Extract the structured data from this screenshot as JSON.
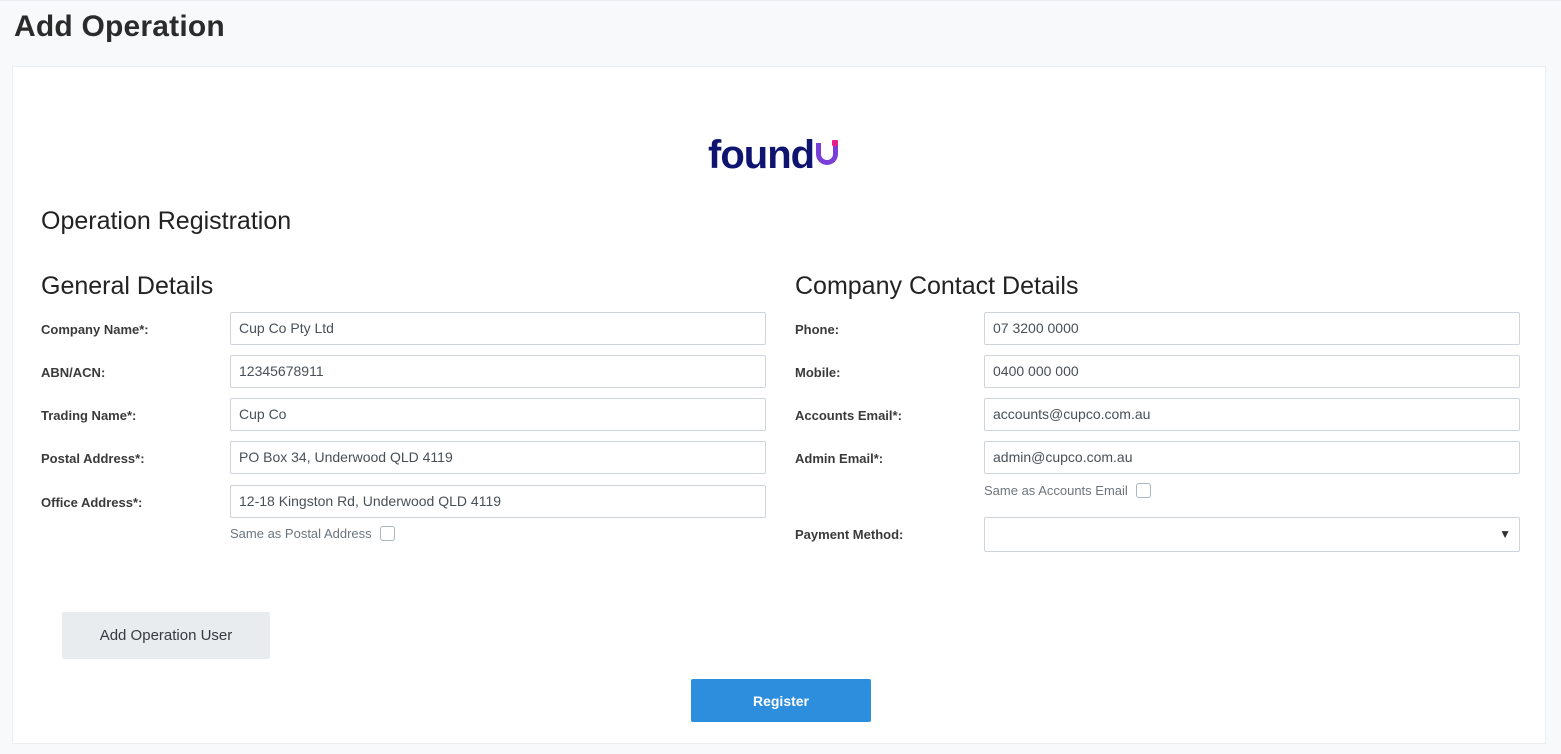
{
  "page": {
    "title": "Add Operation"
  },
  "brand": {
    "logo_text": "found",
    "logo_navy": "#0f1470",
    "logo_purple": "#7a3fd8",
    "logo_pink": "#e91e8c"
  },
  "form": {
    "heading": "Operation Registration",
    "general": {
      "heading": "General Details",
      "company_name": {
        "label": "Company Name*:",
        "value": "Cup Co Pty Ltd"
      },
      "abn": {
        "label": "ABN/ACN:",
        "value": "12345678911"
      },
      "trading_name": {
        "label": "Trading Name*:",
        "value": "Cup Co"
      },
      "postal_address": {
        "label": "Postal Address*:",
        "value": "PO Box 34, Underwood QLD 4119"
      },
      "office_address": {
        "label": "Office Address*:",
        "value": "12-18 Kingston Rd, Underwood QLD 4119"
      },
      "same_as_postal": {
        "label": "Same as Postal Address",
        "checked": false
      }
    },
    "contact": {
      "heading": "Company Contact Details",
      "phone": {
        "label": "Phone:",
        "value": "07 3200 0000"
      },
      "mobile": {
        "label": "Mobile:",
        "value": "0400 000 000"
      },
      "accounts_email": {
        "label": "Accounts Email*:",
        "value": "accounts@cupco.com.au"
      },
      "admin_email": {
        "label": "Admin Email*:",
        "value": "admin@cupco.com.au"
      },
      "same_as_accounts": {
        "label": "Same as Accounts Email",
        "checked": false
      },
      "payment_method": {
        "label": "Payment Method:",
        "value": ""
      }
    },
    "add_user_label": "Add Operation User",
    "register_label": "Register"
  },
  "colors": {
    "primary": "#2e8ede",
    "secondary_bg": "#e9ecef",
    "border": "#ced4da"
  }
}
